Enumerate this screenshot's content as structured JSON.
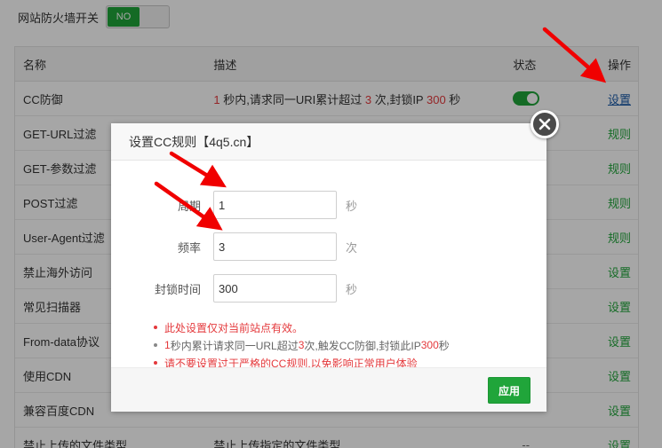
{
  "firewall": {
    "label": "网站防火墙开关",
    "switch_text": "NO"
  },
  "table": {
    "headers": {
      "name": "名称",
      "desc": "描述",
      "status": "状态",
      "op": "操作"
    },
    "cc_row": {
      "name": "CC防御",
      "desc_parts": [
        "1",
        " 秒内,请求同一URI累计超过 ",
        "3",
        " 次,封锁IP ",
        "300",
        " 秒"
      ],
      "op": "设置"
    },
    "rows": [
      {
        "name": "GET-URL过滤",
        "desc": "",
        "op": "规则"
      },
      {
        "name": "GET-参数过滤",
        "desc": "",
        "op": "规则"
      },
      {
        "name": "POST过滤",
        "desc": "",
        "op": "规则"
      },
      {
        "name": "User-Agent过滤",
        "desc": "",
        "op": "规则"
      },
      {
        "name": "禁止海外访问",
        "desc": "",
        "op": "设置"
      },
      {
        "name": "常见扫描器",
        "desc": "",
        "op": "设置"
      },
      {
        "name": "From-data协议",
        "desc": "",
        "op": "设置"
      },
      {
        "name": "使用CDN",
        "desc": "",
        "op": "设置"
      },
      {
        "name": "兼容百度CDN",
        "desc": "",
        "op": "设置"
      },
      {
        "name": "禁止上传的文件类型",
        "desc": "禁止上传指定的文件类型",
        "status": "--",
        "op": "设置"
      }
    ]
  },
  "dialog": {
    "title": "设置CC规则【4q5.cn】",
    "fields": {
      "period": {
        "label": "周期",
        "value": "1",
        "unit": "秒"
      },
      "frequency": {
        "label": "频率",
        "value": "3",
        "unit": "次"
      },
      "block_time": {
        "label": "封锁时间",
        "value": "300",
        "unit": "秒"
      }
    },
    "notes": {
      "n1": "此处设置仅对当前站点有效。",
      "n2_parts": [
        "1",
        " 秒内累计请求同一URL超过 ",
        "3",
        " 次,触发CC防御,封锁此IP ",
        "300",
        " 秒"
      ],
      "n3": "请不要设置过于严格的CC规则,以免影响正常用户体验"
    },
    "apply_label": "应用"
  },
  "colors": {
    "accent": "#20a53a",
    "warning": "#e4393c",
    "link": "#1a5aa8",
    "arrow": "#f00000"
  }
}
